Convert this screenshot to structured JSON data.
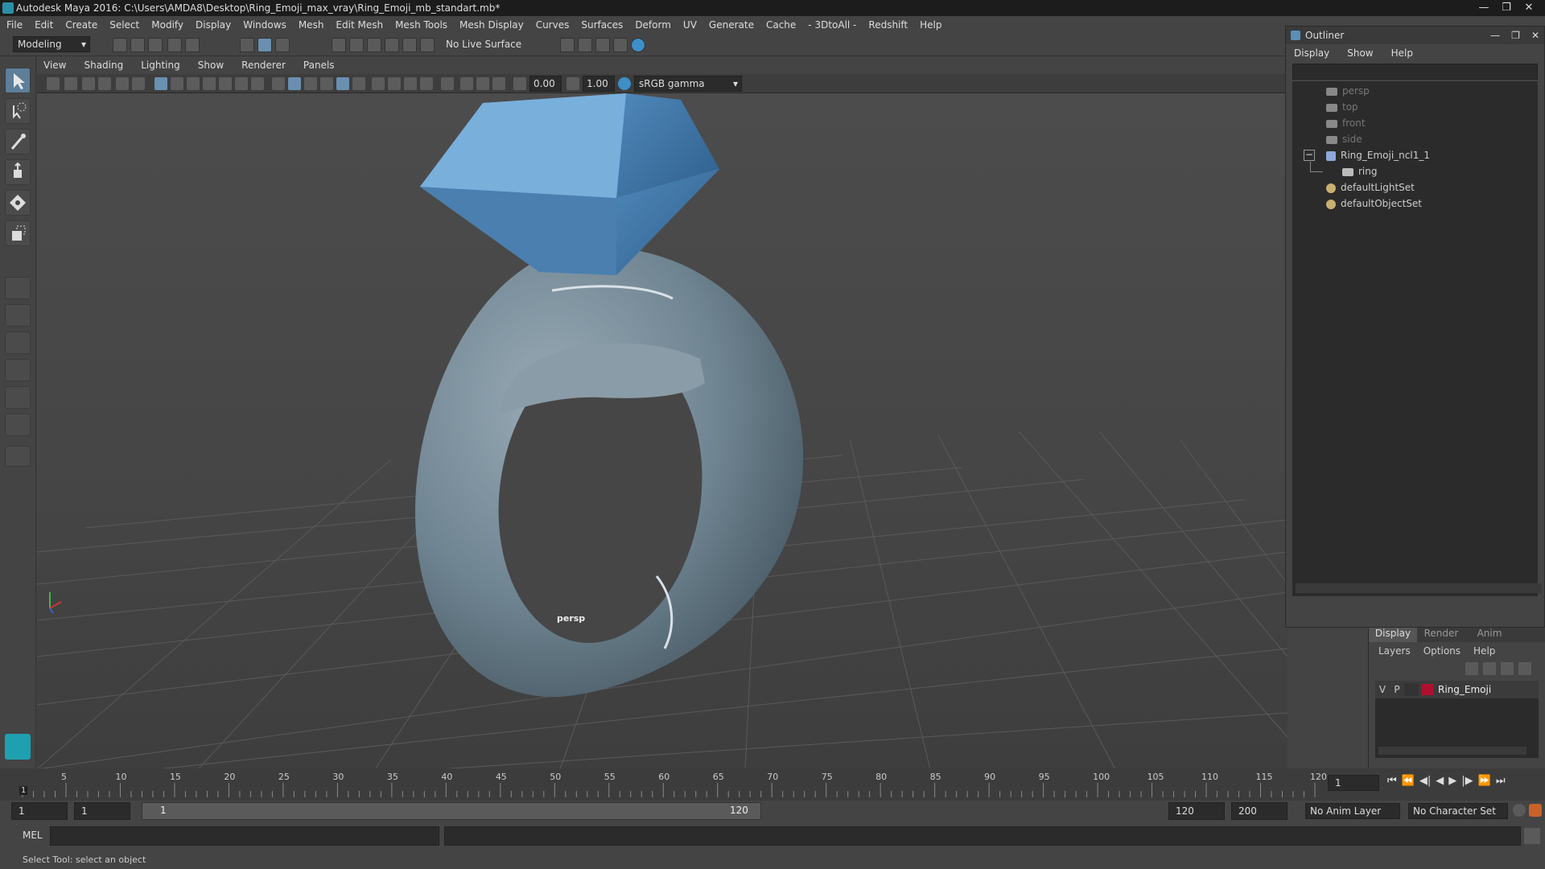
{
  "window": {
    "title": "Autodesk Maya 2016: C:\\Users\\AMDA8\\Desktop\\Ring_Emoji_max_vray\\Ring_Emoji_mb_standart.mb*",
    "controls": [
      "—",
      "❐",
      "✕"
    ]
  },
  "menubar": {
    "items": [
      "File",
      "Edit",
      "Create",
      "Select",
      "Modify",
      "Display",
      "Windows",
      "Mesh",
      "Edit Mesh",
      "Mesh Tools",
      "Mesh Display",
      "Curves",
      "Surfaces",
      "Deform",
      "UV",
      "Generate",
      "Cache",
      "- 3DtoAll -",
      "Redshift",
      "Help"
    ]
  },
  "statusline": {
    "mode": "Modeling",
    "live_surface": "No Live Surface"
  },
  "viewport": {
    "menu": [
      "View",
      "Shading",
      "Lighting",
      "Show",
      "Renderer",
      "Panels"
    ],
    "exposure": "0.00",
    "gamma": "1.00",
    "colorspace": "sRGB gamma",
    "camera_label": "persp"
  },
  "outliner": {
    "title": "Outliner",
    "controls": [
      "—",
      "❐",
      "✕"
    ],
    "menu": [
      "Display",
      "Show",
      "Help"
    ],
    "nodes": [
      {
        "label": "persp",
        "icon": "camera-icon",
        "dim": true
      },
      {
        "label": "top",
        "icon": "camera-icon",
        "dim": true
      },
      {
        "label": "front",
        "icon": "camera-icon",
        "dim": true
      },
      {
        "label": "side",
        "icon": "camera-icon",
        "dim": true
      },
      {
        "label": "Ring_Emoji_ncl1_1",
        "icon": "group-icon",
        "dim": false
      },
      {
        "label": "ring",
        "icon": "mesh-icon",
        "dim": false
      },
      {
        "label": "defaultLightSet",
        "icon": "set-icon",
        "dim": false
      },
      {
        "label": "defaultObjectSet",
        "icon": "set-icon",
        "dim": false
      }
    ],
    "collapse_glyph": "−"
  },
  "layer_panel": {
    "tabs": [
      "Display",
      "Render",
      "Anim"
    ],
    "menu": [
      "Layers",
      "Options",
      "Help"
    ],
    "layer": {
      "v": "V",
      "p": "P",
      "name": "Ring_Emoji",
      "color": "#b01030"
    }
  },
  "timeline": {
    "ticks": [
      "5",
      "10",
      "15",
      "20",
      "25",
      "30",
      "35",
      "40",
      "45",
      "50",
      "55",
      "60",
      "65",
      "70",
      "75",
      "80",
      "85",
      "90",
      "95",
      "100",
      "105",
      "110",
      "115",
      "120"
    ],
    "first_tick": "1",
    "current_frame": "1"
  },
  "playback": {
    "buttons": [
      "⏮",
      "⏪",
      "◀|",
      "◀",
      "▶",
      "|▶",
      "⏩",
      "⏭"
    ]
  },
  "range": {
    "start": "1",
    "range_start": "1",
    "slider_start": "1",
    "slider_end": "120",
    "range_end": "120",
    "end": "200",
    "anim_layer": "No Anim Layer",
    "char_set": "No Character Set"
  },
  "cmdline": {
    "label": "MEL"
  },
  "helpline": {
    "text": "Select Tool: select an object"
  }
}
